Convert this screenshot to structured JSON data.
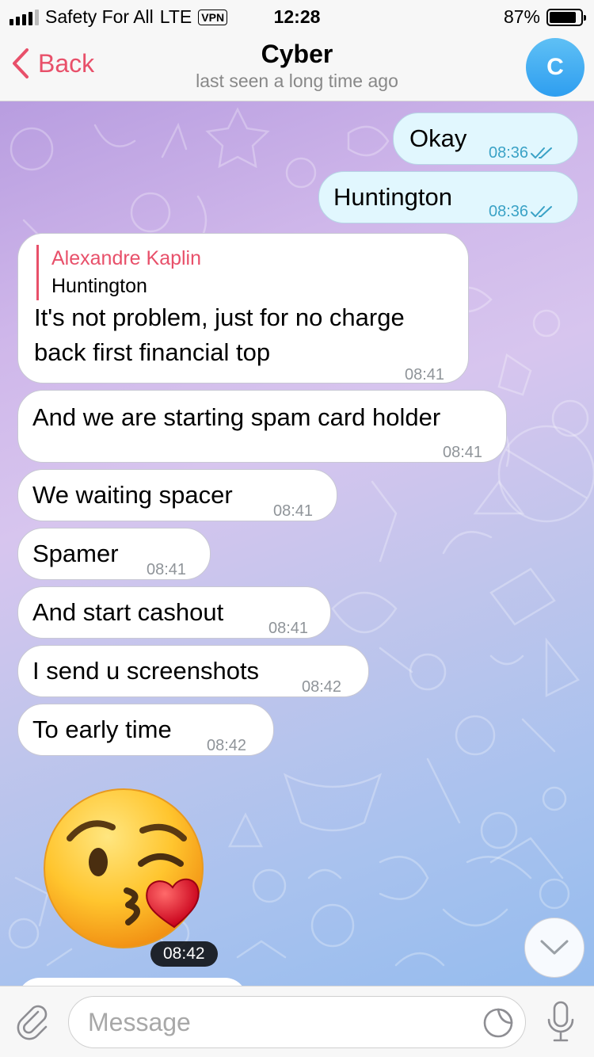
{
  "status_bar": {
    "carrier": "Safety For All",
    "network": "LTE",
    "vpn": "VPN",
    "time": "12:28",
    "battery_percent": "87%",
    "battery_level": 0.87,
    "signal_bars_filled": 4,
    "signal_bars_total": 5
  },
  "nav": {
    "back_label": "Back",
    "title": "Cyber",
    "subtitle": "last seen a long time ago",
    "avatar_initial": "C"
  },
  "messages": [
    {
      "direction": "out",
      "text": "Okay",
      "time": "08:36",
      "read": true
    },
    {
      "direction": "out",
      "text": "Huntington",
      "time": "08:36",
      "read": true
    },
    {
      "direction": "in",
      "reply_to": {
        "name": "Alexandre Kaplin",
        "text": "Huntington"
      },
      "text_lines": [
        "It's not problem, just for no charge",
        "back first financial top"
      ],
      "time": "08:41"
    },
    {
      "direction": "in",
      "text": "And we are starting spam card holder",
      "time": "08:41"
    },
    {
      "direction": "in",
      "text": "We waiting spacer",
      "time": "08:41"
    },
    {
      "direction": "in",
      "text": "Spamer",
      "time": "08:41"
    },
    {
      "direction": "in",
      "text": "And start cashout",
      "time": "08:41"
    },
    {
      "direction": "in",
      "text": "I send u screenshots",
      "time": "08:42"
    },
    {
      "direction": "in",
      "text": "To early time",
      "time": "08:42"
    },
    {
      "direction": "in",
      "sticker": "kissing-face-with-heart",
      "time": "08:42"
    }
  ],
  "input": {
    "placeholder": "Message"
  },
  "icons": {
    "attach": "paperclip-icon",
    "sticker": "sticker-icon",
    "mic": "microphone-icon",
    "scroll_down": "chevron-down-icon",
    "back": "chevron-left-icon",
    "read": "double-check-icon"
  },
  "colors": {
    "accent": "#e8506a",
    "outgoing_bubble": "#e1f7fe",
    "incoming_bubble": "#ffffff",
    "read_check": "#3aa2c6",
    "avatar": "#2e9ef0"
  }
}
